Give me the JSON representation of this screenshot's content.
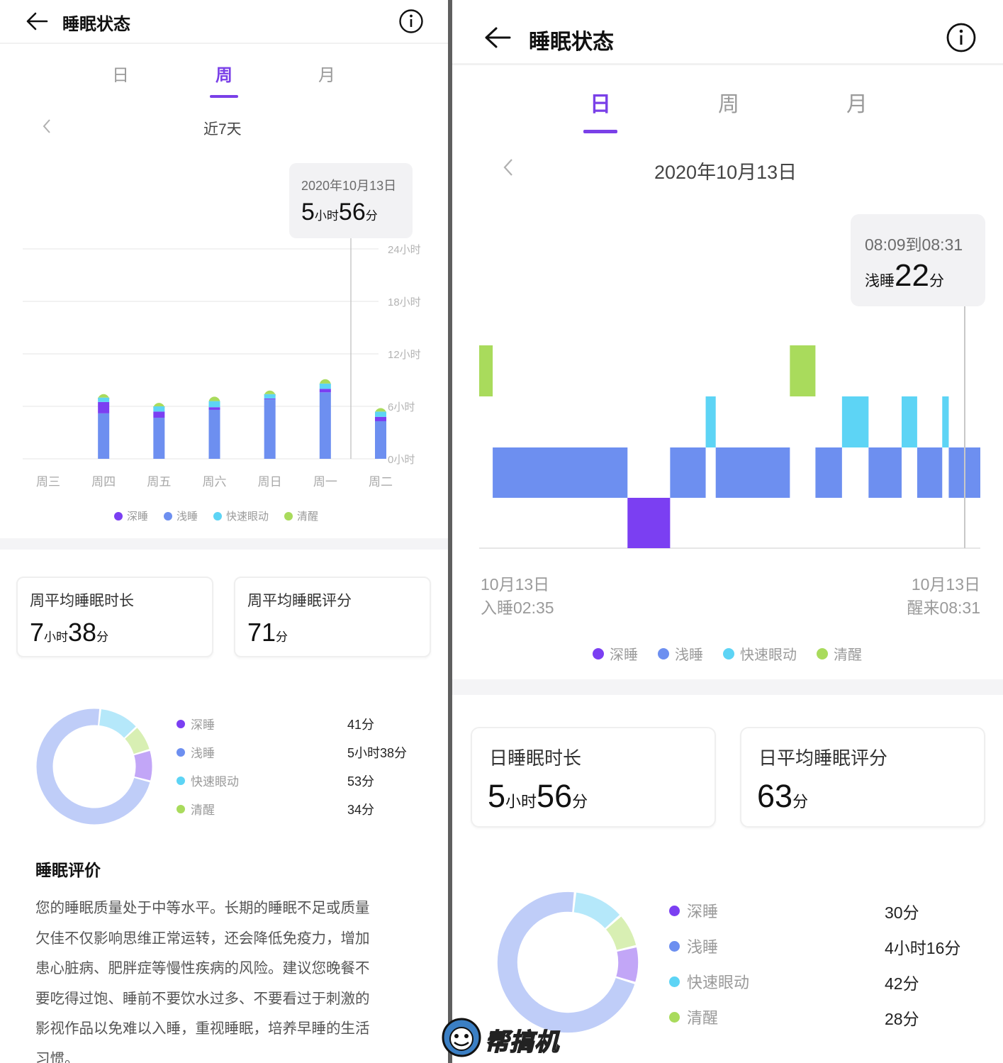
{
  "left": {
    "header": {
      "title": "睡眠状态"
    },
    "tabs": [
      {
        "label": "日"
      },
      {
        "label": "周"
      },
      {
        "label": "月"
      }
    ],
    "active_tab": "周",
    "range_label": "近7天",
    "tooltip": {
      "date": "2020年10月13日",
      "hours": "5",
      "hours_unit": "小时",
      "minutes": "56",
      "minutes_unit": "分"
    },
    "legend": [
      {
        "label": "深睡"
      },
      {
        "label": "浅睡"
      },
      {
        "label": "快速眼动"
      },
      {
        "label": "清醒"
      }
    ],
    "cards": [
      {
        "title": "周平均睡眠时长",
        "big1": "7",
        "unit1": "小时",
        "big2": "38",
        "unit2": "分"
      },
      {
        "title": "周平均睡眠评分",
        "big1": "71",
        "unit1": "分"
      }
    ],
    "donut": {
      "rows": [
        {
          "label": "深睡",
          "value": "41分"
        },
        {
          "label": "浅睡",
          "value": "5小时38分"
        },
        {
          "label": "快速眼动",
          "value": "53分"
        },
        {
          "label": "清醒",
          "value": "34分"
        }
      ],
      "minutes": [
        41,
        338,
        53,
        34
      ]
    },
    "evaluation": {
      "title": "睡眠评价",
      "lines": [
        "您的睡眠质量处于中等水平。长期的睡眠不足或质量",
        "欠佳不仅影响思维正常运转，还会降低免疫力，增加",
        "患心脏病、肥胖症等慢性疾病的风险。建议您晚餐不",
        "要吃得过饱、睡前不要饮水过多、不要看过于刺激的",
        "影视作品以免难以入睡，重视睡眠，培养早睡的生活",
        "习惯。"
      ]
    }
  },
  "right": {
    "header": {
      "title": "睡眠状态"
    },
    "tabs": [
      {
        "label": "日"
      },
      {
        "label": "周"
      },
      {
        "label": "月"
      }
    ],
    "active_tab": "日",
    "date_label": "2020年10月13日",
    "tooltip": {
      "range": "08:09到08:31",
      "stage": "浅睡",
      "minutes": "22",
      "minutes_unit": "分"
    },
    "axis": {
      "start_date": "10月13日",
      "start_text": "入睡02:35",
      "end_date": "10月13日",
      "end_text": "醒来08:31"
    },
    "legend": [
      {
        "label": "深睡"
      },
      {
        "label": "浅睡"
      },
      {
        "label": "快速眼动"
      },
      {
        "label": "清醒"
      }
    ],
    "cards": [
      {
        "title": "日睡眠时长",
        "big1": "5",
        "unit1": "小时",
        "big2": "56",
        "unit2": "分"
      },
      {
        "title": "日平均睡眠评分",
        "big1": "63",
        "unit1": "分"
      }
    ],
    "donut": {
      "rows": [
        {
          "label": "深睡",
          "value": "30分"
        },
        {
          "label": "浅睡",
          "value": "4小时16分"
        },
        {
          "label": "快速眼动",
          "value": "42分"
        },
        {
          "label": "清醒",
          "value": "28分"
        }
      ],
      "minutes": [
        30,
        256,
        42,
        28
      ]
    }
  },
  "colors": {
    "deep": "#7b3ff2",
    "light": "#6d8ff0",
    "rem": "#5dd4f5",
    "awake": "#a9db5c",
    "donut_deep": "#c2a6f7",
    "donut_light": "#bfcdf8",
    "donut_rem": "#b5e8fa",
    "donut_awake": "#d8efb3",
    "accent": "#7a40e8"
  },
  "watermark": {
    "text": "帮搞机"
  },
  "chart_data": [
    {
      "type": "bar",
      "stacked": true,
      "categories": [
        "周三",
        "周四",
        "周五",
        "周六",
        "周日",
        "周一",
        "周二"
      ],
      "yticks": [
        "24小时",
        "18小时",
        "12小时",
        "6小时",
        "0小时"
      ],
      "ylim": [
        0,
        24
      ],
      "series": [
        {
          "name": "深睡",
          "values": [
            0,
            1.3,
            0.7,
            0.3,
            0.1,
            0.4,
            0.5
          ]
        },
        {
          "name": "浅睡",
          "values": [
            0,
            5.2,
            4.7,
            5.6,
            6.8,
            7.6,
            4.3
          ]
        },
        {
          "name": "快速眼动",
          "values": [
            0,
            0.5,
            0.6,
            0.7,
            0.5,
            0.6,
            0.6
          ]
        },
        {
          "name": "清醒",
          "values": [
            0,
            0.4,
            0.4,
            0.5,
            0.4,
            0.5,
            0.4
          ]
        }
      ],
      "grid": true,
      "legend_position": "bottom"
    },
    {
      "type": "bar",
      "subtype": "hypnogram",
      "x_start": "02:35",
      "x_end": "08:31",
      "stages": [
        "清醒",
        "快速眼动",
        "浅睡",
        "深睡"
      ],
      "segments": [
        {
          "stage": "清醒",
          "start": 0,
          "end": 0.027
        },
        {
          "stage": "浅睡",
          "start": 0.027,
          "end": 0.296
        },
        {
          "stage": "深睡",
          "start": 0.296,
          "end": 0.381
        },
        {
          "stage": "浅睡",
          "start": 0.381,
          "end": 0.452
        },
        {
          "stage": "快速眼动",
          "start": 0.452,
          "end": 0.472
        },
        {
          "stage": "浅睡",
          "start": 0.472,
          "end": 0.62
        },
        {
          "stage": "清醒",
          "start": 0.62,
          "end": 0.671
        },
        {
          "stage": "浅睡",
          "start": 0.671,
          "end": 0.724
        },
        {
          "stage": "快速眼动",
          "start": 0.724,
          "end": 0.777
        },
        {
          "stage": "浅睡",
          "start": 0.777,
          "end": 0.843
        },
        {
          "stage": "快速眼动",
          "start": 0.843,
          "end": 0.874
        },
        {
          "stage": "浅睡",
          "start": 0.874,
          "end": 0.924
        },
        {
          "stage": "快速眼动",
          "start": 0.924,
          "end": 0.937
        },
        {
          "stage": "浅睡",
          "start": 0.937,
          "end": 1.0
        }
      ],
      "legend_position": "bottom"
    }
  ]
}
